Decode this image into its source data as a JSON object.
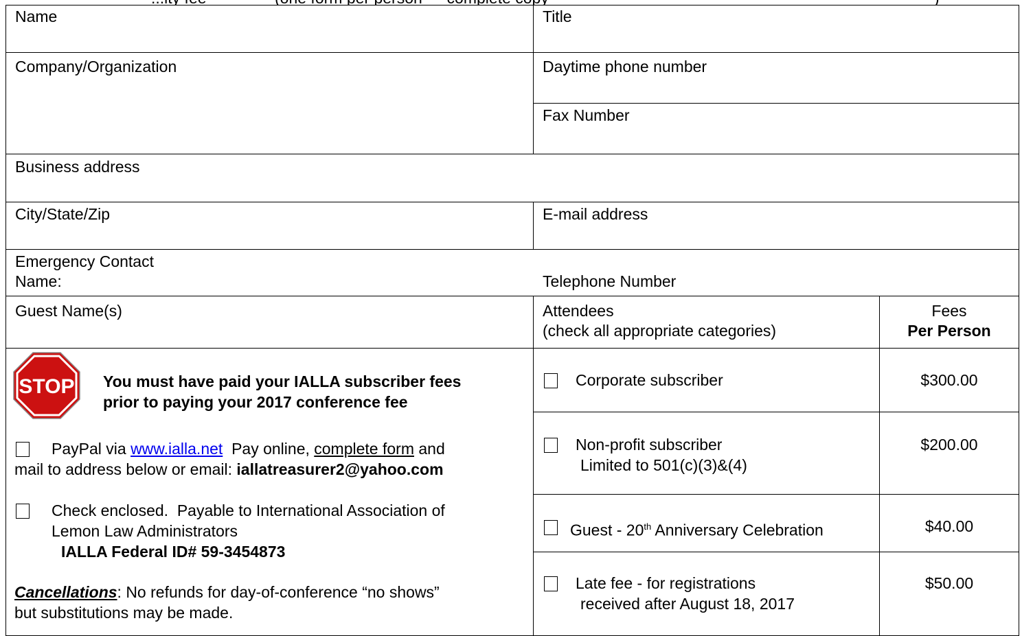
{
  "top_cut": {
    "left": "...ity fee",
    "middle": "(one form per person — complete copy",
    "right": ")"
  },
  "fields": {
    "name": "Name",
    "title": "Title",
    "company": "Company/Organization",
    "daytime_phone": "Daytime phone number",
    "fax": "Fax Number",
    "business_address": "Business address",
    "city_state_zip": "City/State/Zip",
    "email": "E-mail address",
    "emergency_contact": "Emergency Contact",
    "emergency_name": "Name:",
    "emergency_phone": "Telephone Number",
    "guest_names": "Guest Name(s)",
    "attendees_line1": "Attendees",
    "attendees_line2": "(check all appropriate categories)",
    "fees_line1": "Fees",
    "fees_line2": "Per Person"
  },
  "stop_notice": {
    "icon_text": "STOP",
    "line1": "You must have paid your IALLA subscriber fees",
    "line2": "prior to paying your 2017 conference fee"
  },
  "payment": {
    "paypal_prefix": "PayPal via ",
    "paypal_link": "www.ialla.net",
    "paypal_mid": "  Pay online, ",
    "paypal_form": "complete form",
    "paypal_suffix": " and",
    "paypal_line2_text": "mail to address below or email: ",
    "paypal_email": "iallatreasurer2@yahoo.com",
    "check_line1": "Check enclosed.  Payable to International Association of",
    "check_line2": "Lemon Law Administrators",
    "check_line3": "IALLA Federal ID# 59-3454873",
    "cancel_label": "Cancellations",
    "cancel_text": ": No refunds for day-of-conference “no shows”",
    "cancel_line2": "but substitutions may be made."
  },
  "categories": [
    {
      "line1": "Corporate subscriber",
      "line2": "",
      "fee": "$300.00"
    },
    {
      "line1": "Non-profit subscriber",
      "line2": "Limited to 501(c)(3)&(4)",
      "fee": "$200.00"
    },
    {
      "line1_a": "Guest - 20",
      "line1_sup": "th",
      "line1_b": " Anniversary Celebration",
      "fee": "$40.00"
    },
    {
      "line1": "Late fee - for registrations",
      "line2": "received after August 18, 2017",
      "fee": "$50.00"
    }
  ]
}
